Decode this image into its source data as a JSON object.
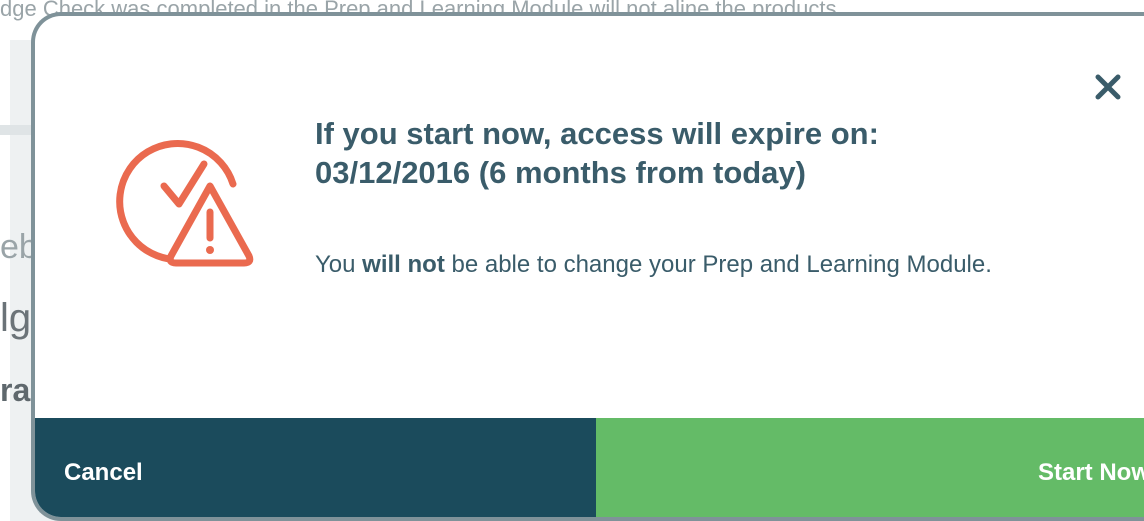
{
  "background": {
    "top_text": "dge Check was completed in the Prep and Learning Module will not aline the products",
    "fragments": [
      "eb",
      "lg",
      "ra"
    ]
  },
  "modal": {
    "heading_line1": "If you start now, access will expire on:",
    "heading_line2": "03/12/2016 (6 months from today)",
    "body_prefix": "You ",
    "body_bold": "will not",
    "body_suffix": " be able to change your Prep and Learning Module.",
    "close_icon": "close-icon",
    "warning_icon": "clock-warning-icon",
    "cancel_label": "Cancel",
    "start_label": "Start Now"
  },
  "colors": {
    "heading": "#3a5c6a",
    "icon": "#ea6a4f",
    "cancel_bg": "#1b4b5c",
    "start_bg": "#64bb67",
    "modal_border": "#7f9299"
  }
}
